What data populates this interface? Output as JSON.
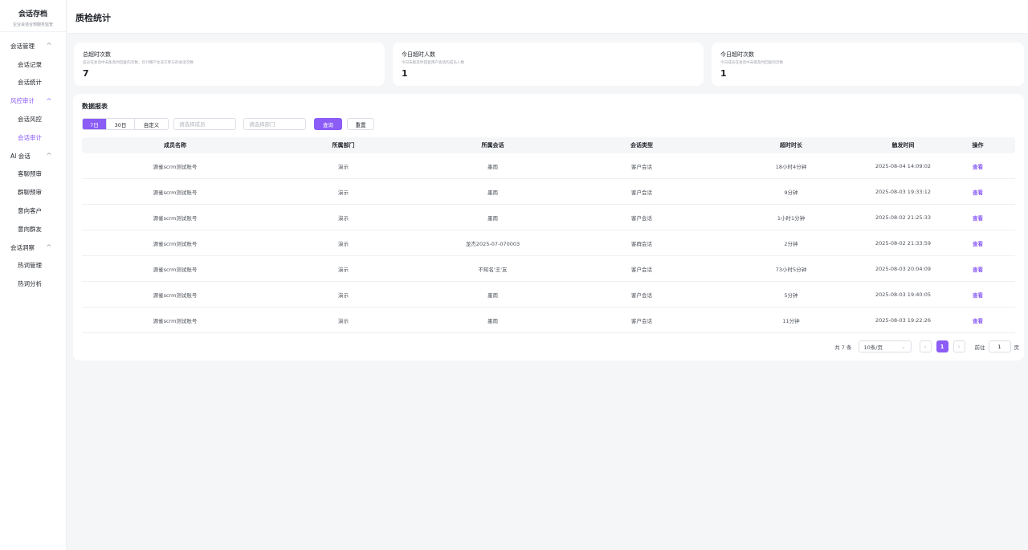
{
  "brand": {
    "title": "会话存档",
    "subtitle": "企业会话合规服务监管"
  },
  "sidebar": {
    "groups": [
      {
        "label": "会话管理",
        "items": [
          "会话记录",
          "会话统计"
        ]
      },
      {
        "label": "风控审计",
        "items": [
          "会话风控",
          "会话审计"
        ]
      },
      {
        "label": "AI 会话",
        "items": [
          "客聊预审",
          "群聊预审",
          "意向客户",
          "意向群友"
        ]
      },
      {
        "label": "会话洞察",
        "items": [
          "热词管理",
          "热词分析"
        ]
      }
    ]
  },
  "header": {
    "title": "质检统计"
  },
  "stats": [
    {
      "label": "总超时次数",
      "desc": "成员在会话中未能及时回复的次数，仅计算产生双方参与的会话次数",
      "value": "7"
    },
    {
      "label": "今日超时人数",
      "desc": "今日未能及时回复用户会话的成员人数",
      "value": "1"
    },
    {
      "label": "今日超时次数",
      "desc": "今日成员在会话中未能及时回复的次数",
      "value": "1"
    }
  ],
  "report": {
    "title": "数据报表",
    "ranges": [
      "7日",
      "30日",
      "自定义"
    ],
    "member_placeholder": "请选择成员",
    "dept_placeholder": "请选择部门",
    "query_label": "查询",
    "reset_label": "重置",
    "columns": [
      "成员名称",
      "所属部门",
      "所属会话",
      "会话类型",
      "超时时长",
      "触发时间",
      "操作"
    ],
    "rows": [
      [
        "源雀scrm测试账号",
        "演示",
        "墨雨",
        "客户会话",
        "18小时4分钟",
        "2025-08-04 14:09:02",
        "查看"
      ],
      [
        "源雀scrm测试账号",
        "演示",
        "墨雨",
        "客户会话",
        "9分钟",
        "2025-08-03 19:33:12",
        "查看"
      ],
      [
        "源雀scrm测试账号",
        "演示",
        "墨雨",
        "客户会话",
        "1小时1分钟",
        "2025-08-02 21:25:33",
        "查看"
      ],
      [
        "源雀scrm测试账号",
        "演示",
        "龙杰2025-07-070003",
        "客群会话",
        "2分钟",
        "2025-08-02 21:33:59",
        "查看"
      ],
      [
        "源雀scrm测试账号",
        "演示",
        "不知名'王'友",
        "客户会话",
        "73小时5分钟",
        "2025-08-03 20:04:09",
        "查看"
      ],
      [
        "源雀scrm测试账号",
        "演示",
        "墨雨",
        "客户会话",
        "5分钟",
        "2025-08-03 19:40:05",
        "查看"
      ],
      [
        "源雀scrm测试账号",
        "演示",
        "墨雨",
        "客户会话",
        "11分钟",
        "2025-08-03 19:22:26",
        "查看"
      ]
    ]
  },
  "pagination": {
    "total": "共 7 条",
    "page_size": "10条/页",
    "current_page": "1",
    "goto_prefix": "前往",
    "goto_value": "1",
    "goto_suffix": "页"
  },
  "colors": {
    "accent": "#8b5cf6",
    "background": "#f5f6f8"
  }
}
